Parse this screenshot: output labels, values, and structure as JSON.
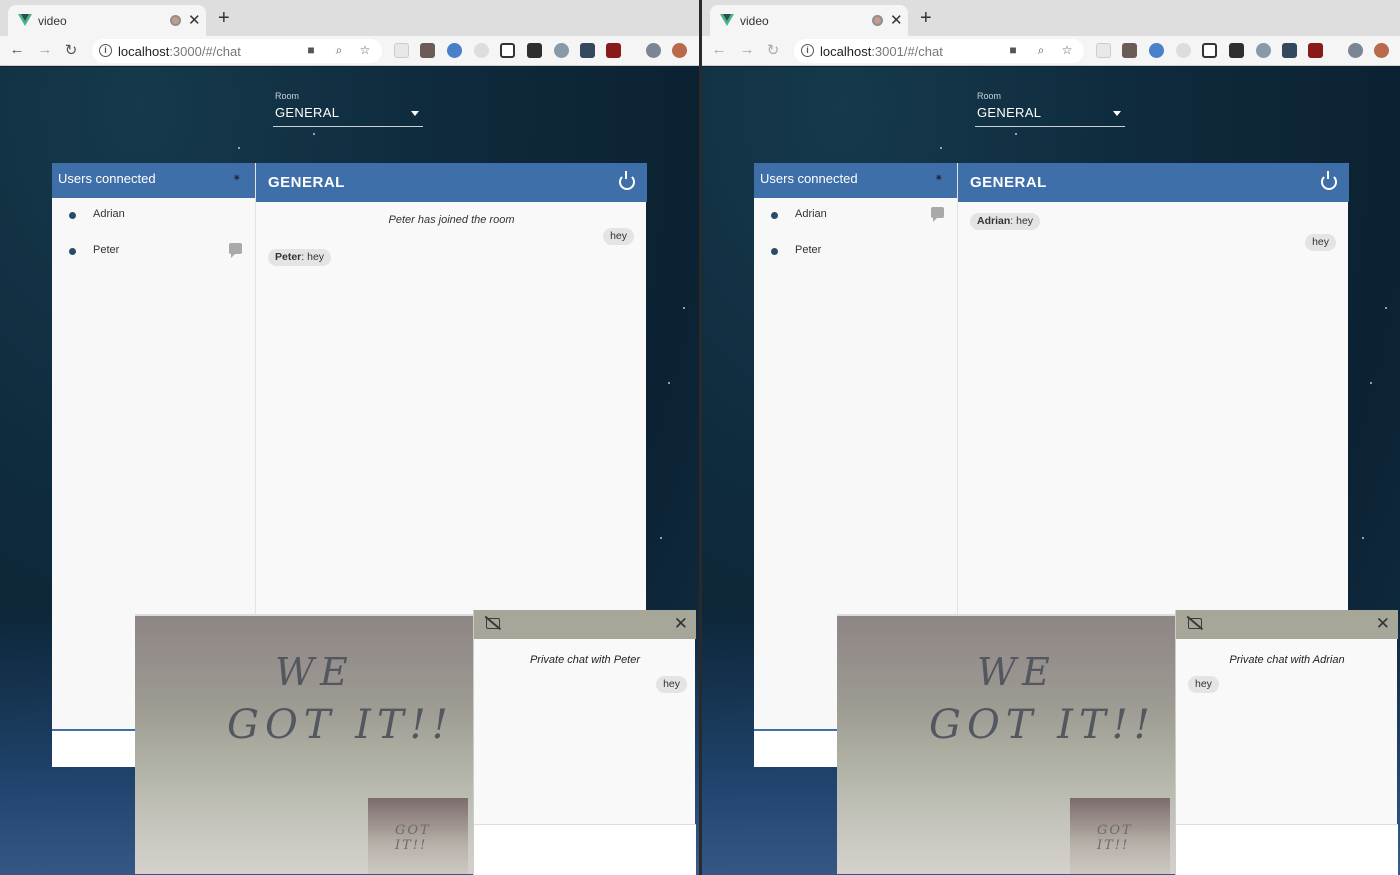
{
  "left": {
    "tab_title": "video",
    "url_host": "localhost",
    "url_rest": ":3000/#/chat",
    "room_label": "Room",
    "room_value": "GENERAL",
    "users_header": "Users connected",
    "users": [
      {
        "name": "Adrian",
        "has_bubble": false
      },
      {
        "name": "Peter",
        "has_bubble": true
      }
    ],
    "chat_title": "GENERAL",
    "notice": "Peter has joined the room",
    "messages": [
      {
        "sender": "",
        "text": "hey",
        "side": "right"
      },
      {
        "sender": "Peter",
        "text": ": hey",
        "side": "left"
      }
    ],
    "video_text_line1": "WE",
    "video_text_line2": "GOT IT!!",
    "private_title": "Private chat with Peter",
    "private_message": {
      "text": "hey",
      "side": "right"
    }
  },
  "right": {
    "tab_title": "video",
    "url_host": "localhost",
    "url_rest": ":3001/#/chat",
    "room_label": "Room",
    "room_value": "GENERAL",
    "users_header": "Users connected",
    "users": [
      {
        "name": "Adrian",
        "has_bubble": true
      },
      {
        "name": "Peter",
        "has_bubble": false
      }
    ],
    "chat_title": "GENERAL",
    "messages": [
      {
        "sender": "Adrian",
        "text": ": hey",
        "side": "left"
      },
      {
        "sender": "",
        "text": "hey",
        "side": "right"
      }
    ],
    "video_text_line1": "WE",
    "video_text_line2": "GOT IT!!",
    "private_title": "Private chat with Adrian",
    "private_message": {
      "text": "hey",
      "side": "left"
    }
  },
  "colors": {
    "header_blue": "#3f6fa8",
    "private_header": "#a6a799",
    "page_background": "#0d2334"
  },
  "icons": [
    "vue-logo-icon",
    "record-icon",
    "close-icon",
    "plus-icon",
    "back-icon",
    "forward-icon",
    "reload-icon",
    "info-icon",
    "camera-icon",
    "zoom-icon",
    "star-icon",
    "dropdown-arrow-icon",
    "settings-icon",
    "chat-bubble-icon",
    "power-icon",
    "video-off-icon"
  ]
}
